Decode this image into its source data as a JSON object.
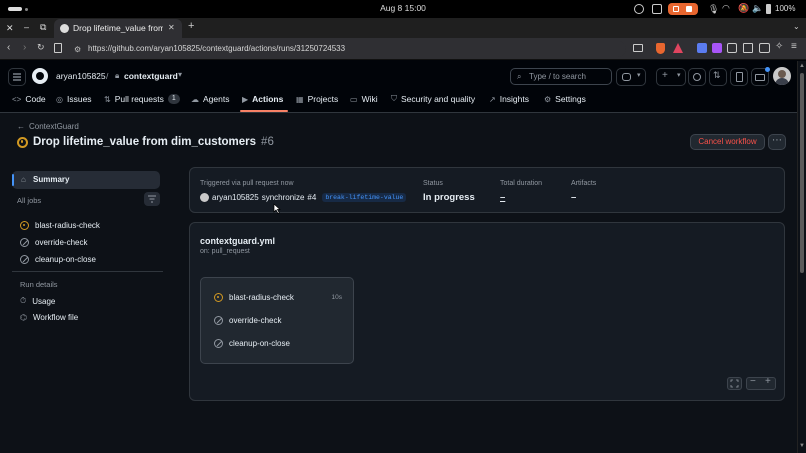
{
  "os": {
    "clock": "Aug 8  15:00",
    "battery": "100%"
  },
  "browser": {
    "tab_title": "Drop lifetime_value from dim_customers #6",
    "url": "https://github.com/aryan105825/contextguard/actions/runs/31250724533"
  },
  "header": {
    "owner": "aryan105825",
    "separator": "/",
    "repo": "contextguard",
    "search_placeholder": "Type / to search"
  },
  "nav": {
    "code": "Code",
    "issues": "Issues",
    "pulls": "Pull requests",
    "pulls_count": "1",
    "agents": "Agents",
    "actions": "Actions",
    "projects": "Projects",
    "wiki": "Wiki",
    "security": "Security and quality",
    "insights": "Insights",
    "settings": "Settings"
  },
  "run": {
    "back_link": "ContextGuard",
    "title": "Drop lifetime_value from dim_customers",
    "number": "#6",
    "cancel_label": "Cancel workflow"
  },
  "sidebar": {
    "summary": "Summary",
    "all_jobs": "All jobs",
    "jobs": [
      {
        "name": "blast-radius-check",
        "status": "in-progress"
      },
      {
        "name": "override-check",
        "status": "skipped"
      },
      {
        "name": "cleanup-on-close",
        "status": "skipped"
      }
    ],
    "run_details": "Run details",
    "usage": "Usage",
    "workflow_file": "Workflow file"
  },
  "summary": {
    "trigger_label": "Triggered via pull request now",
    "actor": "aryan105825",
    "action": "synchronize",
    "pr": "#4",
    "branch": "break-lifetime-value",
    "status_label": "Status",
    "status_value": "In progress",
    "duration_label": "Total duration",
    "duration_value": "–",
    "artifacts_label": "Artifacts",
    "artifacts_value": "–"
  },
  "workflow": {
    "file": "contextguard.yml",
    "on": "on: pull_request",
    "jobs": [
      {
        "name": "blast-radius-check",
        "status": "in-progress",
        "time": "10s"
      },
      {
        "name": "override-check",
        "status": "skipped",
        "time": ""
      },
      {
        "name": "cleanup-on-close",
        "status": "skipped",
        "time": ""
      }
    ]
  },
  "colors": {
    "accent": "#f78166",
    "in_progress": "#d29922",
    "danger": "#f85149"
  }
}
